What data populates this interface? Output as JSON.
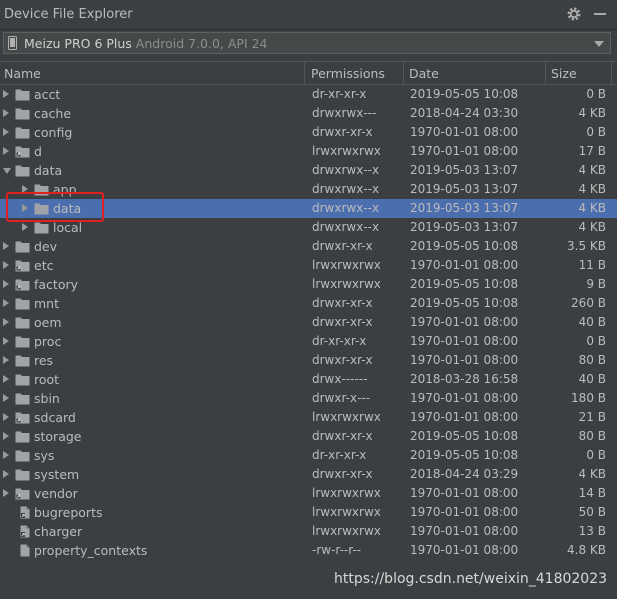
{
  "window": {
    "title": "Device File Explorer"
  },
  "device": {
    "name": "Meizu PRO 6 Plus",
    "info": "Android 7.0.0, API 24"
  },
  "columns": {
    "name": "Name",
    "permissions": "Permissions",
    "date": "Date",
    "size": "Size"
  },
  "rows": [
    {
      "name": "acct",
      "perm": "dr-xr-xr-x",
      "date": "2019-05-05 10:08",
      "size": "0 B",
      "level": 0,
      "toggle": "closed",
      "icon": "folder-icon"
    },
    {
      "name": "cache",
      "perm": "drwxrwx---",
      "date": "2018-04-24 03:30",
      "size": "4 KB",
      "level": 0,
      "toggle": "closed",
      "icon": "folder-icon"
    },
    {
      "name": "config",
      "perm": "drwxr-xr-x",
      "date": "1970-01-01 08:00",
      "size": "0 B",
      "level": 0,
      "toggle": "closed",
      "icon": "folder-icon"
    },
    {
      "name": "d",
      "perm": "lrwxrwxrwx",
      "date": "1970-01-01 08:00",
      "size": "17 B",
      "level": 0,
      "toggle": "closed",
      "icon": "folder-link-icon"
    },
    {
      "name": "data",
      "perm": "drwxrwx--x",
      "date": "2019-05-03 13:07",
      "size": "4 KB",
      "level": 0,
      "toggle": "open",
      "icon": "folder-icon"
    },
    {
      "name": "app",
      "perm": "drwxrwx--x",
      "date": "2019-05-03 13:07",
      "size": "4 KB",
      "level": 1,
      "toggle": "closed",
      "icon": "folder-icon"
    },
    {
      "name": "data",
      "perm": "drwxrwx--x",
      "date": "2019-05-03 13:07",
      "size": "4 KB",
      "level": 1,
      "toggle": "closed",
      "icon": "folder-icon",
      "selected": true
    },
    {
      "name": "local",
      "perm": "drwxrwx--x",
      "date": "2019-05-03 13:07",
      "size": "4 KB",
      "level": 1,
      "toggle": "closed",
      "icon": "folder-icon"
    },
    {
      "name": "dev",
      "perm": "drwxr-xr-x",
      "date": "2019-05-05 10:08",
      "size": "3.5 KB",
      "level": 0,
      "toggle": "closed",
      "icon": "folder-icon"
    },
    {
      "name": "etc",
      "perm": "lrwxrwxrwx",
      "date": "1970-01-01 08:00",
      "size": "11 B",
      "level": 0,
      "toggle": "closed",
      "icon": "folder-link-icon"
    },
    {
      "name": "factory",
      "perm": "lrwxrwxrwx",
      "date": "2019-05-05 10:08",
      "size": "9 B",
      "level": 0,
      "toggle": "closed",
      "icon": "folder-link-icon"
    },
    {
      "name": "mnt",
      "perm": "drwxr-xr-x",
      "date": "2019-05-05 10:08",
      "size": "260 B",
      "level": 0,
      "toggle": "closed",
      "icon": "folder-icon"
    },
    {
      "name": "oem",
      "perm": "drwxr-xr-x",
      "date": "1970-01-01 08:00",
      "size": "40 B",
      "level": 0,
      "toggle": "closed",
      "icon": "folder-icon"
    },
    {
      "name": "proc",
      "perm": "dr-xr-xr-x",
      "date": "1970-01-01 08:00",
      "size": "0 B",
      "level": 0,
      "toggle": "closed",
      "icon": "folder-icon"
    },
    {
      "name": "res",
      "perm": "drwxr-xr-x",
      "date": "1970-01-01 08:00",
      "size": "80 B",
      "level": 0,
      "toggle": "closed",
      "icon": "folder-icon"
    },
    {
      "name": "root",
      "perm": "drwx------",
      "date": "2018-03-28 16:58",
      "size": "40 B",
      "level": 0,
      "toggle": "closed",
      "icon": "folder-icon"
    },
    {
      "name": "sbin",
      "perm": "drwxr-x---",
      "date": "1970-01-01 08:00",
      "size": "180 B",
      "level": 0,
      "toggle": "closed",
      "icon": "folder-icon"
    },
    {
      "name": "sdcard",
      "perm": "lrwxrwxrwx",
      "date": "1970-01-01 08:00",
      "size": "21 B",
      "level": 0,
      "toggle": "closed",
      "icon": "folder-link-icon"
    },
    {
      "name": "storage",
      "perm": "drwxr-xr-x",
      "date": "2019-05-05 10:08",
      "size": "80 B",
      "level": 0,
      "toggle": "closed",
      "icon": "folder-icon"
    },
    {
      "name": "sys",
      "perm": "dr-xr-xr-x",
      "date": "2019-05-05 10:08",
      "size": "0 B",
      "level": 0,
      "toggle": "closed",
      "icon": "folder-icon"
    },
    {
      "name": "system",
      "perm": "drwxr-xr-x",
      "date": "2018-04-24 03:29",
      "size": "4 KB",
      "level": 0,
      "toggle": "closed",
      "icon": "folder-icon"
    },
    {
      "name": "vendor",
      "perm": "lrwxrwxrwx",
      "date": "1970-01-01 08:00",
      "size": "14 B",
      "level": 0,
      "toggle": "closed",
      "icon": "folder-link-icon"
    },
    {
      "name": "bugreports",
      "perm": "lrwxrwxrwx",
      "date": "1970-01-01 08:00",
      "size": "50 B",
      "level": 0,
      "toggle": "none",
      "icon": "file-link-icon"
    },
    {
      "name": "charger",
      "perm": "lrwxrwxrwx",
      "date": "1970-01-01 08:00",
      "size": "13 B",
      "level": 0,
      "toggle": "none",
      "icon": "file-link-icon"
    },
    {
      "name": "property_contexts",
      "perm": "-rw-r--r--",
      "date": "1970-01-01 08:00",
      "size": "4.8 KB",
      "level": 0,
      "toggle": "none",
      "icon": "file-icon"
    }
  ],
  "watermark": "https://blog.csdn.net/weixin_41802023",
  "colors": {
    "selection": "#4b6eaf",
    "highlight_box": "#e02020",
    "background": "#3c3f41"
  }
}
